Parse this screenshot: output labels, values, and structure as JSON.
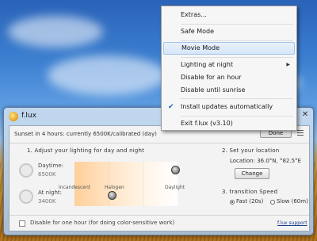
{
  "window": {
    "title": "f.lux",
    "close_glyph": "✕",
    "status": "Sunset in 4 hours: currently 6500K/calibrated (day)",
    "done_label": "Done"
  },
  "lighting": {
    "title": "1. Adjust your lighting for day and night",
    "daytime_label": "Daytime:",
    "daytime_value": "6500K",
    "night_label": "At night:",
    "night_value": "3400K",
    "ticks": {
      "incandescent": "Incandescent",
      "halogen": "Halogen",
      "daylight": "Daylight"
    }
  },
  "location": {
    "title": "2. Set your location",
    "coords": "Location: 36.0°N, °82.5°E",
    "change_label": "Change"
  },
  "transition": {
    "title": "3. transition Speed",
    "fast_label": "Fast (20s)",
    "slow_label": "Slow (60m)",
    "selected": "fast"
  },
  "footer": {
    "disable_label": "Disable for one hour (for doing color-sensitive work)",
    "support_link": "f.lux support"
  },
  "menu": {
    "extras": "Extras...",
    "safe_mode": "Safe Mode",
    "movie_mode": "Movie Mode",
    "lighting_at_night": "Lighting at night",
    "disable_hour": "Disable for an hour",
    "disable_sunrise": "Disable until sunrise",
    "install_updates": "Install updates automatically",
    "exit": "Exit f.lux (v3.10)",
    "submenu_arrow": "▶",
    "check_glyph": "✔"
  }
}
